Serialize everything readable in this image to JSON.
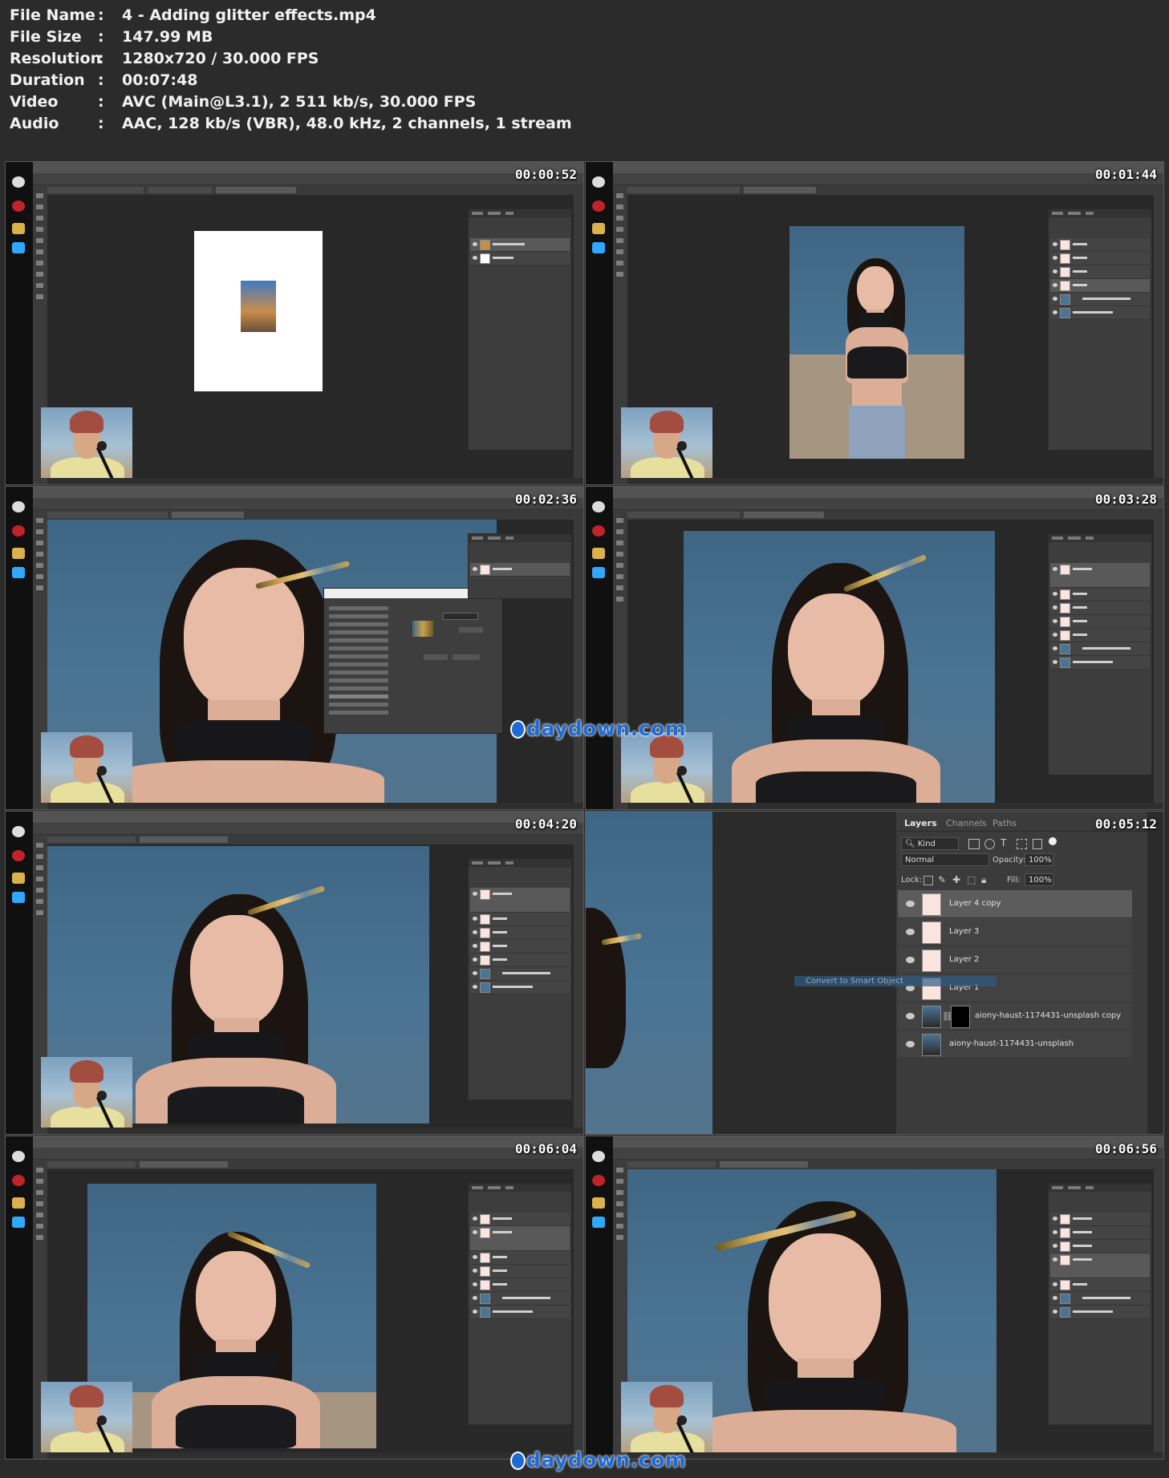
{
  "info": {
    "rows": [
      {
        "key": "File Name",
        "value": "4 - Adding glitter effects.mp4"
      },
      {
        "key": "File Size",
        "value": "147.99 MB"
      },
      {
        "key": "Resolution",
        "value": "1280x720 / 30.000 FPS"
      },
      {
        "key": "Duration",
        "value": "00:07:48"
      },
      {
        "key": "Video",
        "value": "AVC (Main@L3.1), 2 511 kb/s, 30.000 FPS"
      },
      {
        "key": "Audio",
        "value": "AAC, 128 kb/s (VBR), 48.0 kHz, 2 channels, 1 stream"
      }
    ],
    "separator": ":"
  },
  "thumbnails": [
    {
      "timestamp": "00:00:52"
    },
    {
      "timestamp": "00:01:44"
    },
    {
      "timestamp": "00:02:36"
    },
    {
      "timestamp": "00:03:28"
    },
    {
      "timestamp": "00:04:20"
    },
    {
      "timestamp": "00:05:12"
    },
    {
      "timestamp": "00:06:04"
    },
    {
      "timestamp": "00:06:56"
    }
  ],
  "watermark": {
    "text": "daydown.com",
    "color": "#1f6bd6"
  },
  "layers_panel": {
    "tabs": [
      "Layers",
      "Channels",
      "Paths"
    ],
    "kind_label": "Kind",
    "blend_mode": "Normal",
    "opacity_label": "Opacity:",
    "opacity_value": "100%",
    "lock_label": "Lock:",
    "fill_label": "Fill:",
    "fill_value": "100%",
    "layers": [
      {
        "name": "Layer 4 copy",
        "selected": true
      },
      {
        "name": "Layer 3",
        "selected": false
      },
      {
        "name": "Layer 2",
        "selected": false
      },
      {
        "name": "Layer 1",
        "selected": false
      },
      {
        "name": "aiony-haust-1174431-unsplash copy",
        "selected": false
      },
      {
        "name": "aiony-haust-1174431-unsplash",
        "selected": false
      }
    ],
    "context_menu_item": "Convert to Smart Object"
  },
  "colors": {
    "background": "#2b2b2b",
    "photoshop_ui": "#535353",
    "panel": "#3d3d3d",
    "selected_layer": "#5c5c5c"
  },
  "icons": [
    "eye-icon",
    "search-icon",
    "lock-icon",
    "chain-link-icon",
    "layer-mask-icon"
  ]
}
